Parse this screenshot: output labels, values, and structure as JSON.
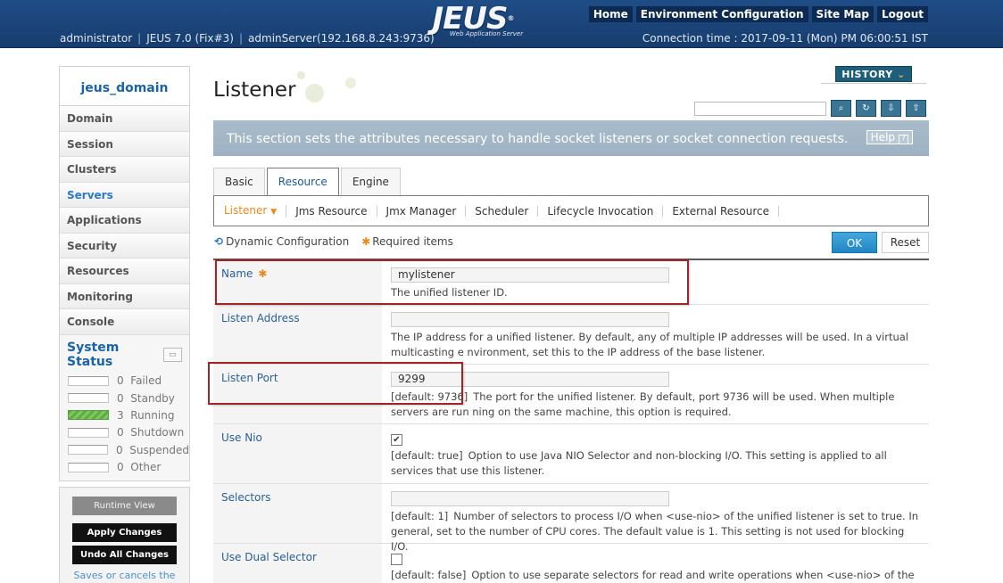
{
  "header": {
    "logo_text": "JEUS",
    "logo_reg": "®",
    "logo_sub": "Web Application Server",
    "nav": [
      "Home",
      "Environment Configuration",
      "Site Map",
      "Logout"
    ],
    "user": "administrator",
    "version": "JEUS 7.0 (Fix#3)",
    "server": "adminServer(192.168.8.243:9736)",
    "connection_time": "Connection time : 2017-09-11 (Mon) PM 06:00:51 IST"
  },
  "sidebar": {
    "domain": "jeus_domain",
    "items": [
      "Domain",
      "Session",
      "Clusters",
      "Servers",
      "Applications",
      "Security",
      "Resources",
      "Monitoring",
      "Console"
    ],
    "active_index": 3,
    "system_status_title": "System Status",
    "status": [
      {
        "count": "0",
        "label": "Failed"
      },
      {
        "count": "0",
        "label": "Standby"
      },
      {
        "count": "3",
        "label": "Running"
      },
      {
        "count": "0",
        "label": "Shutdown"
      },
      {
        "count": "0",
        "label": "Suspended"
      },
      {
        "count": "0",
        "label": "Other"
      }
    ],
    "runtime_view": "Runtime View",
    "apply_changes": "Apply Changes",
    "undo_changes": "Undo All Changes",
    "saves_text": "Saves or cancels the"
  },
  "main": {
    "title": "Listener",
    "history": "HISTORY",
    "info": "This section sets the attributes necessary to handle socket listeners or socket connection requests.",
    "help": "Help",
    "tabs": [
      "Basic",
      "Resource",
      "Engine"
    ],
    "subtabs": [
      "Listener",
      "Jms Resource",
      "Jmx Manager",
      "Scheduler",
      "Lifecycle Invocation",
      "External Resource"
    ],
    "dynamic_config": "Dynamic Configuration",
    "required_items": "Required items",
    "ok": "OK",
    "reset": "Reset"
  },
  "form": {
    "name": {
      "label": "Name",
      "value": "mylistener",
      "desc": "The unified listener ID."
    },
    "listen_address": {
      "label": "Listen Address",
      "value": "",
      "desc": "The IP address for a unified listener. By default, any of multiple IP addresses will be used. In a virtual multicasting e nvironment, set this to the IP address of the base listener."
    },
    "listen_port": {
      "label": "Listen Port",
      "value": "9299",
      "default": "[default: 9736]",
      "desc": "The port for the unified listener. By default, port 9736 will be used. When multiple servers are run ning on the same machine, this option is required."
    },
    "use_nio": {
      "label": "Use Nio",
      "checked": true,
      "default": "[default: true]",
      "desc": "Option to use Java NIO Selector and non-blocking I/O. This setting is applied to all services that use this listener."
    },
    "selectors": {
      "label": "Selectors",
      "value": "",
      "default": "[default: 1]",
      "desc": "Number of selectors to process I/O when <use-nio> of the unified listener is set to true. In general, set to the number of CPU cores. The default value is 1. This setting is not used for blocking I/O."
    },
    "use_dual_selector": {
      "label": "Use Dual Selector",
      "checked": false,
      "default": "[default: false]",
      "desc": "Option to use separate selectors for read and write operations when <use-nio> of the unified listen"
    }
  }
}
